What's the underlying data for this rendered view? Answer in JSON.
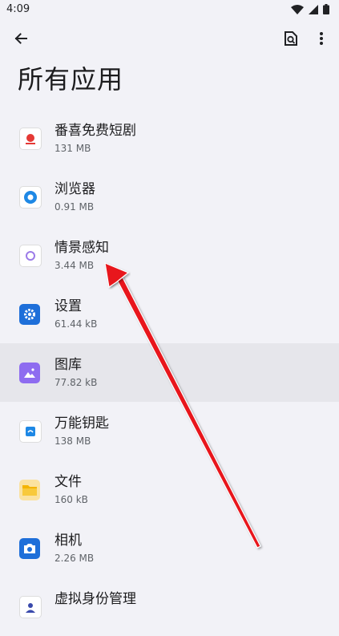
{
  "status_bar": {
    "time": "4:09"
  },
  "page": {
    "title": "所有应用"
  },
  "apps": [
    {
      "name": "番喜免费短剧",
      "size": "131 MB",
      "icon": "red-video-icon",
      "color": "#e53935"
    },
    {
      "name": "浏览器",
      "size": "0.91 MB",
      "icon": "browser-icon",
      "color": "#1e88e5"
    },
    {
      "name": "情景感知",
      "size": "3.44 MB",
      "icon": "context-aware-icon",
      "color": "#9c7be8"
    },
    {
      "name": "设置",
      "size": "61.44 kB",
      "icon": "gear-icon",
      "color": "#1e6fd9"
    },
    {
      "name": "图库",
      "size": "77.82 kB",
      "icon": "gallery-icon",
      "color": "#8e6cf0"
    },
    {
      "name": "万能钥匙",
      "size": "138 MB",
      "icon": "wifi-key-icon",
      "color": "#1e88e5"
    },
    {
      "name": "文件",
      "size": "160 kB",
      "icon": "folder-icon",
      "color": "#f4b400"
    },
    {
      "name": "相机",
      "size": "2.26 MB",
      "icon": "camera-icon",
      "color": "#1e6fd9"
    },
    {
      "name": "虚拟身份管理",
      "size": "",
      "icon": "identity-icon",
      "color": "#3949ab"
    }
  ]
}
